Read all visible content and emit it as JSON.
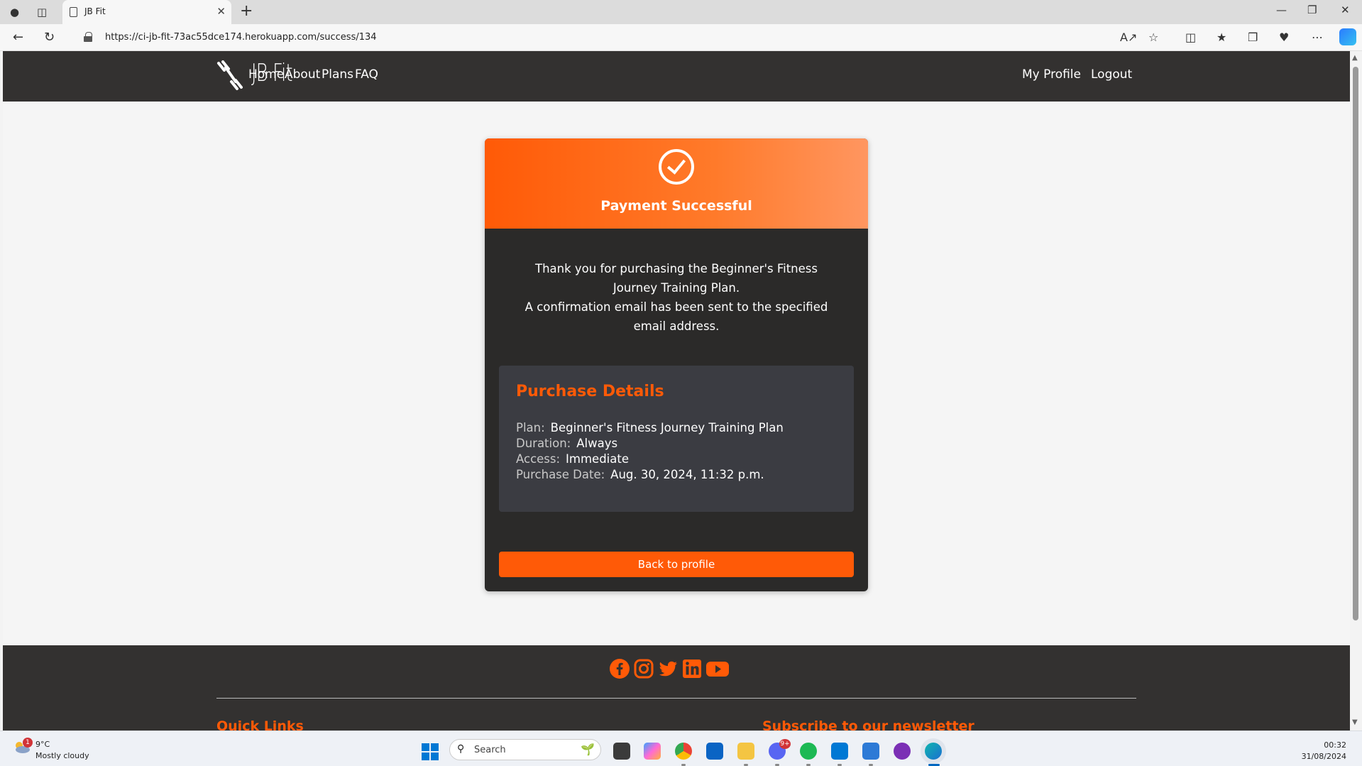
{
  "browser": {
    "tab_title": "JB Fit",
    "url": "https://ci-jb-fit-73ac55dce174.herokuapp.com/success/134"
  },
  "site": {
    "brand": "JB Fit",
    "nav": {
      "home": "Home",
      "about": "About",
      "plans": "Plans",
      "faq": "FAQ",
      "my_profile": "My Profile",
      "logout": "Logout"
    },
    "accent_color": "#ff5a07",
    "dark_color": "#333130"
  },
  "success": {
    "title": "Payment Successful",
    "message_line1": "Thank you for purchasing the Beginner's Fitness Journey Training Plan.",
    "message_line2": "A confirmation email has been sent to the specified email address.",
    "details": {
      "heading": "Purchase Details",
      "plan_label": "Plan:",
      "plan_value": "Beginner's Fitness Journey Training Plan",
      "duration_label": "Duration:",
      "duration_value": "Always",
      "access_label": "Access:",
      "access_value": "Immediate",
      "date_label": "Purchase Date:",
      "date_value": "Aug. 30, 2024, 11:32 p.m."
    },
    "back_button": "Back to profile"
  },
  "footer": {
    "social_icons": [
      "facebook-icon",
      "instagram-icon",
      "twitter-icon",
      "linkedin-icon",
      "youtube-icon"
    ],
    "quick_links": "Quick Links",
    "newsletter": "Subscribe to our newsletter"
  },
  "taskbar": {
    "weather_badge": "1",
    "temperature": "9°C",
    "weather": "Mostly cloudy",
    "search_placeholder": "Search",
    "discord_badge": "9+",
    "time": "00:32",
    "date": "31/08/2024"
  }
}
